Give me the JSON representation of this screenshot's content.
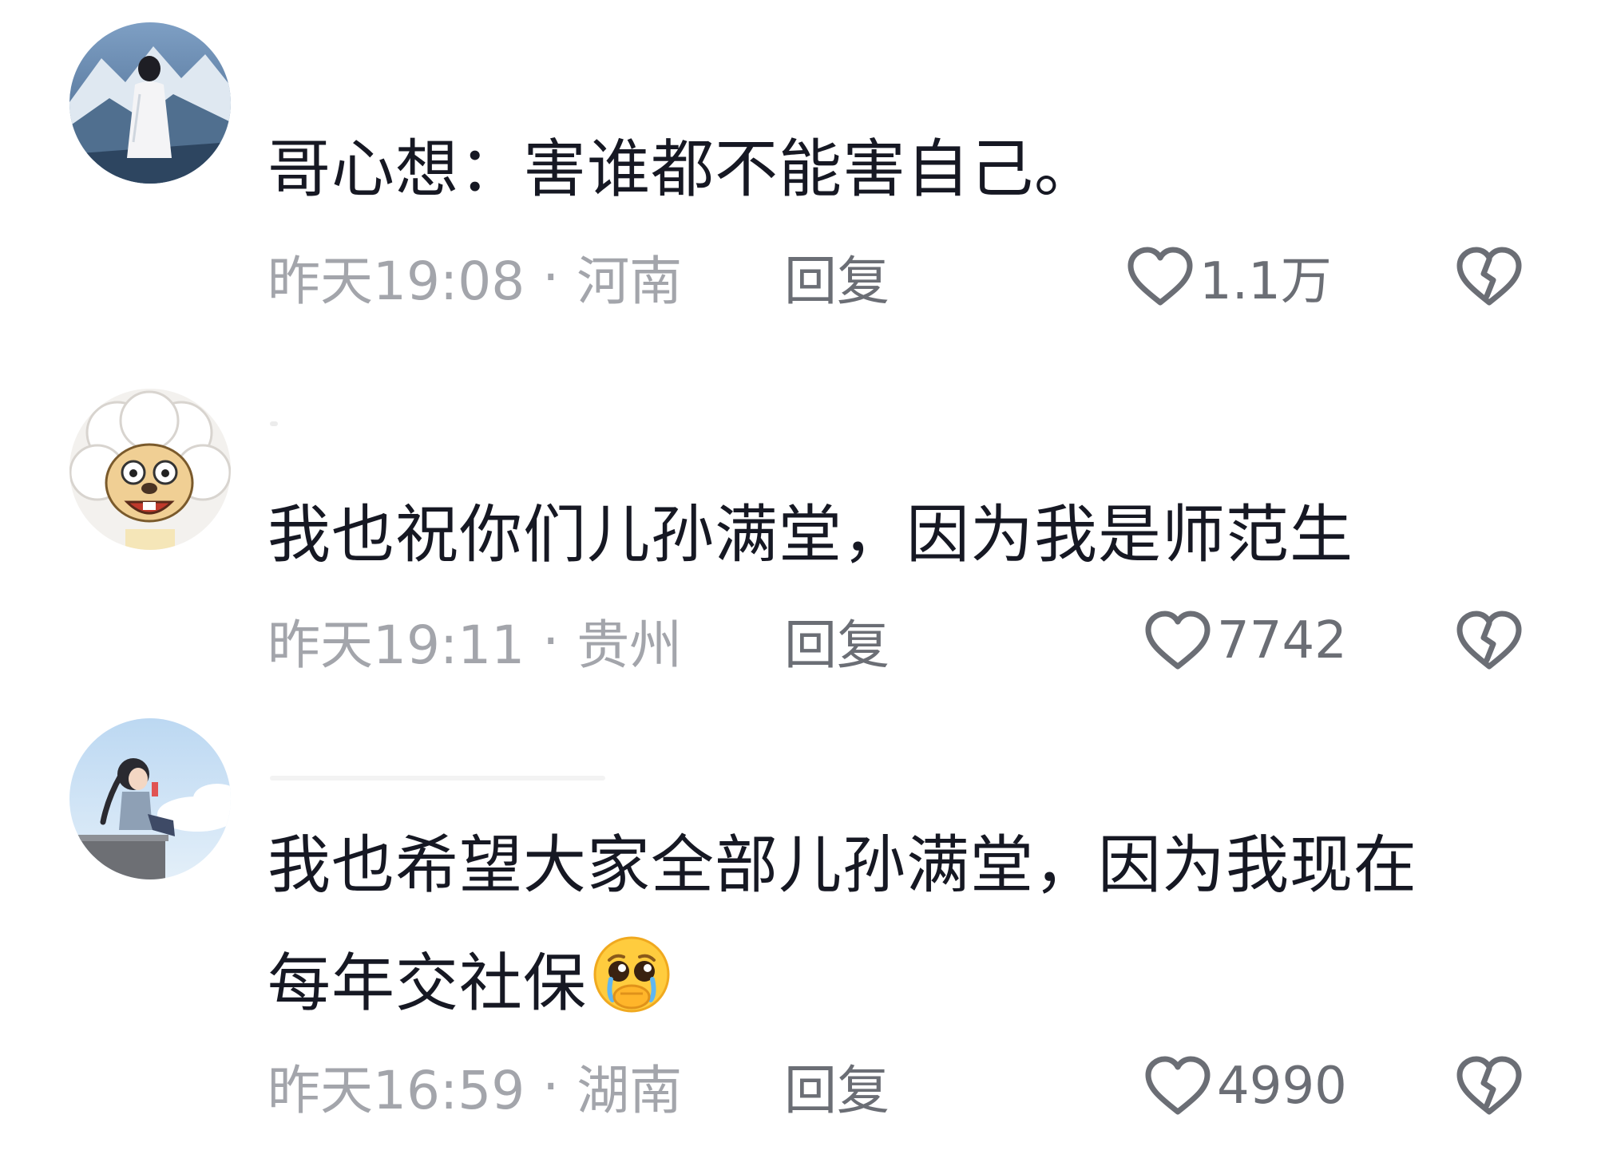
{
  "comments": [
    {
      "text": "哥心想：害谁都不能害自己。",
      "time": "昨天19:08",
      "location": "河南",
      "reply_label": "回复",
      "likes": "1.1万"
    },
    {
      "text": "我也祝你们儿孙满堂，因为我是师范生",
      "time": "昨天19:11",
      "location": "贵州",
      "reply_label": "回复",
      "likes": "7742"
    },
    {
      "text_line1": "我也希望大家全部儿孙满堂，因为我现在",
      "text_line2": "每年交社保",
      "emoji": "pleading-face-emoji",
      "time": "昨天16:59",
      "location": "湖南",
      "reply_label": "回复",
      "likes": "4990"
    }
  ],
  "separator": "·",
  "icons": {
    "like": "heart-outline-icon",
    "dislike": "broken-heart-icon"
  },
  "colors": {
    "text": "#161823",
    "meta": "#a3a5ab",
    "action": "#6b6e75"
  }
}
